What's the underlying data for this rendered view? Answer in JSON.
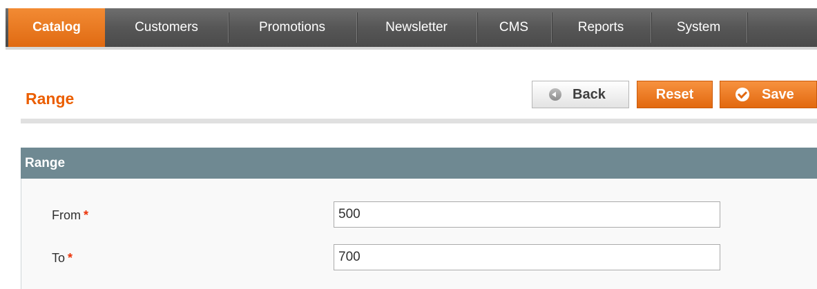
{
  "nav": {
    "items": [
      {
        "label": "Catalog",
        "active": true
      },
      {
        "label": "Customers"
      },
      {
        "label": "Promotions"
      },
      {
        "label": "Newsletter"
      },
      {
        "label": "CMS"
      },
      {
        "label": "Reports"
      },
      {
        "label": "System"
      }
    ]
  },
  "page": {
    "title": "Range",
    "buttons": {
      "back_label": "Back",
      "reset_label": "Reset",
      "save_label": "Save"
    }
  },
  "form": {
    "section_title": "Range",
    "fields": [
      {
        "label": "From",
        "required_mark": "*",
        "value": "500"
      },
      {
        "label": "To",
        "required_mark": "*",
        "value": "700"
      }
    ]
  },
  "colors": {
    "accent": "#eb5e00",
    "nav_bg": "#575757",
    "fieldset_header": "#6f8992"
  },
  "icons": {
    "back": "circle-arrow-left-icon",
    "save": "check-circle-icon"
  }
}
